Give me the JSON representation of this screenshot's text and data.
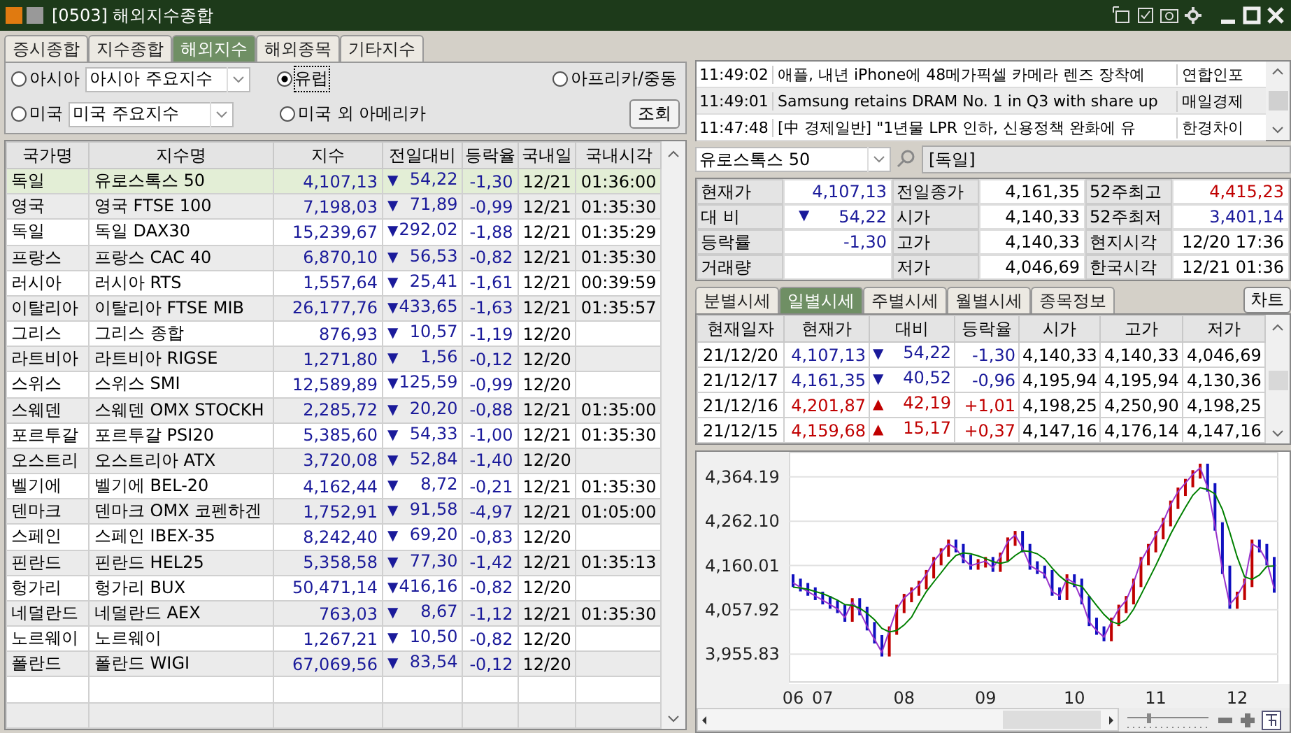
{
  "window": {
    "title": "[0503] 해외지수종합"
  },
  "tabs": [
    {
      "label": "증시종합",
      "selected": false
    },
    {
      "label": "지수종합",
      "selected": false
    },
    {
      "label": "해외지수",
      "selected": true
    },
    {
      "label": "해외종목",
      "selected": false
    },
    {
      "label": "기타지수",
      "selected": false
    }
  ],
  "filter": {
    "regions": [
      {
        "label": "아시아",
        "selected": false,
        "select": "아시아 주요지수"
      },
      {
        "label": "유럽",
        "selected": true
      },
      {
        "label": "아프리카/중동",
        "selected": false
      },
      {
        "label": "미국",
        "selected": false,
        "select": "미국 주요지수"
      },
      {
        "label": "미국 외 아메리카",
        "selected": false
      }
    ],
    "button": "조회"
  },
  "indices": {
    "columns": [
      "국가명",
      "지수명",
      "지수",
      "전일대비",
      "등락율",
      "국내일",
      "국내시각"
    ],
    "rows": [
      {
        "country": "독일",
        "name": "유로스톡스 50",
        "index": "4,107,13",
        "arrow": "▼",
        "change": "54,22",
        "rate": "-1,30",
        "date": "12/21",
        "time": "01:36:00",
        "rising": false,
        "selected": true
      },
      {
        "country": "영국",
        "name": "영국 FTSE 100",
        "index": "7,198,03",
        "arrow": "▼",
        "change": "71,89",
        "rate": "-0,99",
        "date": "12/21",
        "time": "01:35:30",
        "rising": false,
        "selected": false
      },
      {
        "country": "독일",
        "name": "독일 DAX30",
        "index": "15,239,67",
        "arrow": "▼",
        "change": "292,02",
        "rate": "-1,88",
        "date": "12/21",
        "time": "01:35:29",
        "rising": false,
        "selected": false
      },
      {
        "country": "프랑스",
        "name": "프랑스 CAC 40",
        "index": "6,870,10",
        "arrow": "▼",
        "change": "56,53",
        "rate": "-0,82",
        "date": "12/21",
        "time": "01:35:30",
        "rising": false,
        "selected": false
      },
      {
        "country": "러시아",
        "name": "러시아 RTS",
        "index": "1,557,64",
        "arrow": "▼",
        "change": "25,41",
        "rate": "-1,61",
        "date": "12/21",
        "time": "00:39:59",
        "rising": false,
        "selected": false
      },
      {
        "country": "이탈리아",
        "name": "이탈리아 FTSE MIB",
        "index": "26,177,76",
        "arrow": "▼",
        "change": "433,65",
        "rate": "-1,63",
        "date": "12/21",
        "time": "01:35:57",
        "rising": false,
        "selected": false
      },
      {
        "country": "그리스",
        "name": "그리스 종합",
        "index": "876,93",
        "arrow": "▼",
        "change": "10,57",
        "rate": "-1,19",
        "date": "12/20",
        "rising": false,
        "selected": false
      },
      {
        "country": "라트비아",
        "name": "라트비아 RIGSE",
        "index": "1,271,80",
        "arrow": "▼",
        "change": "1,56",
        "rate": "-0,12",
        "date": "12/20",
        "rising": false,
        "selected": false
      },
      {
        "country": "스위스",
        "name": "스위스 SMI",
        "index": "12,589,89",
        "arrow": "▼",
        "change": "125,59",
        "rate": "-0,99",
        "date": "12/20",
        "rising": false,
        "selected": false
      },
      {
        "country": "스웨덴",
        "name": "스웨덴 OMX STOCKH",
        "index": "2,285,72",
        "arrow": "▼",
        "change": "20,20",
        "rate": "-0,88",
        "date": "12/21",
        "time": "01:35:00",
        "rising": false,
        "selected": false
      },
      {
        "country": "포르투갈",
        "name": "포르투갈 PSI20",
        "index": "5,385,60",
        "arrow": "▼",
        "change": "54,33",
        "rate": "-1,00",
        "date": "12/21",
        "time": "01:35:30",
        "rising": false,
        "selected": false
      },
      {
        "country": "오스트리",
        "name": "오스트리아 ATX",
        "index": "3,720,08",
        "arrow": "▼",
        "change": "52,84",
        "rate": "-1,40",
        "date": "12/20",
        "rising": false,
        "selected": false
      },
      {
        "country": "벨기에",
        "name": "벨기에 BEL-20",
        "index": "4,162,44",
        "arrow": "▼",
        "change": "8,72",
        "rate": "-0,21",
        "date": "12/21",
        "time": "01:35:30",
        "rising": false,
        "selected": false
      },
      {
        "country": "덴마크",
        "name": "덴마크 OMX 코펜하겐",
        "index": "1,752,91",
        "arrow": "▼",
        "change": "91,58",
        "rate": "-4,97",
        "date": "12/21",
        "time": "01:05:00",
        "rising": false,
        "selected": false
      },
      {
        "country": "스페인",
        "name": "스페인 IBEX-35",
        "index": "8,242,40",
        "arrow": "▼",
        "change": "69,20",
        "rate": "-0,83",
        "date": "12/20",
        "rising": false,
        "selected": false
      },
      {
        "country": "핀란드",
        "name": "핀란드 HEL25",
        "index": "5,358,58",
        "arrow": "▼",
        "change": "77,30",
        "rate": "-1,42",
        "date": "12/21",
        "time": "01:35:13",
        "rising": false,
        "selected": false
      },
      {
        "country": "헝가리",
        "name": "헝가리 BUX",
        "index": "50,471,14",
        "arrow": "▼",
        "change": "416,16",
        "rate": "-0,82",
        "date": "12/20",
        "rising": false,
        "selected": false
      },
      {
        "country": "네덜란드",
        "name": "네덜란드 AEX",
        "index": "763,03",
        "arrow": "▼",
        "change": "8,67",
        "rate": "-1,12",
        "date": "12/21",
        "time": "01:35:30",
        "rising": false,
        "selected": false
      },
      {
        "country": "노르웨이",
        "name": "노르웨이",
        "index": "1,267,21",
        "arrow": "▼",
        "change": "10,50",
        "rate": "-0,82",
        "date": "12/20",
        "rising": false,
        "selected": false
      },
      {
        "country": "폴란드",
        "name": "폴란드 WIGI",
        "index": "67,069,56",
        "arrow": "▼",
        "change": "83,54",
        "rate": "-0,12",
        "date": "12/20",
        "rising": false,
        "selected": false
      }
    ]
  },
  "news": [
    {
      "time": "11:49:02",
      "headline": "애플, 내년 iPhone에 48메가픽셀 카메라 렌즈 장착예",
      "source": "연합인포"
    },
    {
      "time": "11:49:01",
      "headline": "Samsung retains DRAM No. 1 in Q3 with share up",
      "source": "매일경제"
    },
    {
      "time": "11:47:48",
      "headline": "[中 경제일반] \"1년물 LPR 인하, 신용정책 완화에 유",
      "source": "한경차이"
    }
  ],
  "search": {
    "value": "유로스톡스 50",
    "country": "[독일]"
  },
  "quote": [
    [
      {
        "label": "현재가",
        "value": "4,107,13",
        "rising": false
      },
      {
        "label": "전일종가",
        "value": "4,161,35"
      },
      {
        "label": "52주최고",
        "value": "4,415,23",
        "rising": true
      }
    ],
    [
      {
        "label": "대 비",
        "arrow": "▼",
        "value": "54,22",
        "rising": false
      },
      {
        "label": "시가",
        "value": "4,140,33"
      },
      {
        "label": "52주최저",
        "value": "3,401,14",
        "rising": false
      }
    ],
    [
      {
        "label": "등락률",
        "value": "-1,30",
        "rising": false
      },
      {
        "label": "고가",
        "value": "4,140,33"
      },
      {
        "label": "현지시각",
        "value": "12/20 17:36"
      }
    ],
    [
      {
        "label": "거래량"
      },
      {
        "label": "저가",
        "value": "4,046,69"
      },
      {
        "label": "한국시각",
        "value": "12/21 01:36"
      }
    ]
  ],
  "daily_tabs": [
    {
      "label": "분별시세",
      "selected": false
    },
    {
      "label": "일별시세",
      "selected": true
    },
    {
      "label": "주별시세",
      "selected": false
    },
    {
      "label": "월별시세",
      "selected": false
    },
    {
      "label": "종목정보",
      "selected": false
    }
  ],
  "chart_button": "차트",
  "daily": {
    "columns": [
      "현재일자",
      "현재가",
      "대비",
      "등락율",
      "시가",
      "고가",
      "저가"
    ],
    "rows": [
      {
        "date": "21/12/20",
        "close": "4,107,13",
        "arrow": "▼",
        "change": "54,22",
        "rate": "-1,30",
        "open": "4,140,33",
        "high": "4,140,33",
        "low": "4,046,69",
        "rising": false
      },
      {
        "date": "21/12/17",
        "close": "4,161,35",
        "arrow": "▼",
        "change": "40,52",
        "rate": "-0,96",
        "open": "4,195,94",
        "high": "4,195,94",
        "low": "4,130,36",
        "rising": false
      },
      {
        "date": "21/12/16",
        "close": "4,201,87",
        "arrow": "▲",
        "change": "42,19",
        "rate": "+1,01",
        "open": "4,198,25",
        "high": "4,250,90",
        "low": "4,198,25",
        "rising": true
      },
      {
        "date": "21/12/15",
        "close": "4,159,68",
        "arrow": "▲",
        "change": "15,17",
        "rate": "+0,37",
        "open": "4,147,16",
        "high": "4,176,14",
        "low": "4,147,16",
        "rising": true
      }
    ]
  },
  "chart": {
    "chart_data": {
      "type": "line",
      "grid": true,
      "ylim": [
        3890,
        4422
      ],
      "categories": [
        "06",
        null,
        null,
        null,
        "07",
        null,
        null,
        null,
        null,
        null,
        null,
        null,
        null,
        null,
        null,
        "08",
        null,
        null,
        null,
        null,
        null,
        null,
        null,
        null,
        null,
        null,
        "09",
        null,
        null,
        null,
        null,
        null,
        null,
        null,
        null,
        null,
        null,
        null,
        "10",
        null,
        null,
        null,
        null,
        null,
        null,
        null,
        null,
        null,
        null,
        "11",
        null,
        null,
        null,
        null,
        null,
        null,
        null,
        null,
        null,
        null,
        "12",
        null,
        null,
        null,
        null,
        null
      ],
      "yticks": [
        {
          "value": 4364.19,
          "label": "4,364.19"
        },
        {
          "value": 4262.1,
          "label": "4,262.10"
        },
        {
          "value": 4160.01,
          "label": "4,160.01"
        },
        {
          "value": 4057.92,
          "label": "4,057.92"
        },
        {
          "value": 3955.83,
          "label": "3,955.83"
        }
      ],
      "series": [
        {
          "color": "#9933cc",
          "values": [
            4120,
            4110,
            4100,
            4090,
            4080,
            4070,
            4060,
            4040,
            4075,
            4055,
            4020,
            3990,
            3960,
            4010,
            4060,
            4085,
            4100,
            4115,
            4140,
            4170,
            4190,
            4210,
            4200,
            4175,
            4160,
            4165,
            4170,
            4155,
            4180,
            4215,
            4230,
            4200,
            4160,
            4150,
            4140,
            4100,
            4090,
            4130,
            4120,
            4080,
            4030,
            4010,
            3995,
            4030,
            4060,
            4080,
            4120,
            4170,
            4200,
            4230,
            4260,
            4300,
            4330,
            4350,
            4370,
            4385,
            4340,
            4250,
            4150,
            4070,
            4090,
            4120,
            4210,
            4200,
            4170,
            4107
          ]
        },
        {
          "color": "#008000",
          "values": [
            4110,
            4108,
            4105,
            4100,
            4095,
            4088,
            4080,
            4070,
            4068,
            4062,
            4050,
            4035,
            4015,
            4007,
            4010,
            4023,
            4041,
            4072,
            4100,
            4122,
            4143,
            4165,
            4183,
            4189,
            4187,
            4182,
            4176,
            4169,
            4165,
            4169,
            4183,
            4194,
            4192,
            4187,
            4175,
            4154,
            4136,
            4122,
            4116,
            4112,
            4090,
            4068,
            4047,
            4031,
            4025,
            4035,
            4059,
            4092,
            4126,
            4160,
            4196,
            4232,
            4264,
            4294,
            4322,
            4339,
            4335,
            4325,
            4289,
            4237,
            4180,
            4134,
            4128,
            4138,
            4158,
            4159
          ]
        }
      ]
    }
  }
}
